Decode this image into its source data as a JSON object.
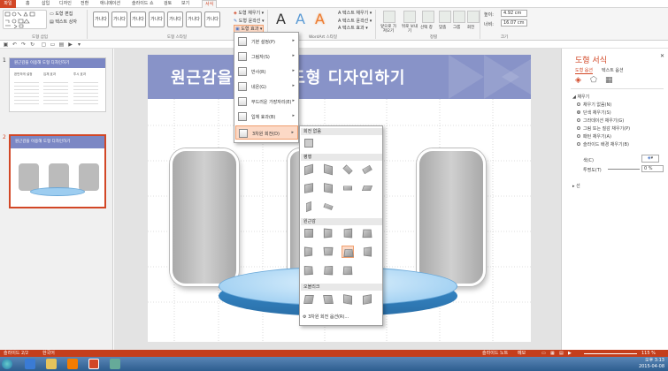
{
  "tabs": [
    "파일",
    "홈",
    "삽입",
    "디자인",
    "전환",
    "애니메이션",
    "슬라이드 쇼",
    "검토",
    "보기",
    "서식"
  ],
  "ribbon": {
    "style_thumb_text": "가나다",
    "shape_styles_label": "도형 스타일",
    "insert_shapes_label": "도형 삽입",
    "edit_shape": "도형 편집",
    "textbox": "텍스트 상자",
    "fill": "도형 채우기",
    "outline": "도형 윤곽선",
    "effects": "도형 효과",
    "wordart_letter": "A",
    "wordart_label": "WordArt 스타일",
    "text_fill": "텍스트 채우기",
    "text_outline": "텍스트 윤곽선",
    "text_effects": "텍스트 효과",
    "arrange_label": "정렬",
    "bring_forward": "앞으로 가져오기",
    "send_backward": "뒤로 보내기",
    "selection_pane": "선택 창",
    "align": "맞춤",
    "group": "그룹",
    "rotate": "회전",
    "size_label": "크기",
    "height_label": "높이:",
    "height_value": "4.92 cm",
    "width_label": "너비:",
    "width_value": "16.07 cm"
  },
  "effects_menu": [
    {
      "label": "기본 설정(P)",
      "arrow": "▸"
    },
    {
      "label": "그림자(S)",
      "arrow": "▸"
    },
    {
      "label": "반사(R)",
      "arrow": "▸"
    },
    {
      "label": "네온(G)",
      "arrow": "▸"
    },
    {
      "label": "부드러운 가장자리(E)",
      "arrow": "▸"
    },
    {
      "label": "입체 효과(B)",
      "arrow": "▸"
    },
    {
      "label": "3차원 회전(D)",
      "arrow": "▸"
    }
  ],
  "gallery": {
    "section_none": "회전 없음",
    "section_parallel": "평행",
    "section_perspective": "원근감",
    "section_oblique": "오블리크",
    "options": "3차원 회전 옵션(R)..."
  },
  "slides": [
    {
      "num": "1",
      "title": "원근감을 이용해 도형 디자인하기"
    },
    {
      "num": "2",
      "title": "원근감을 이용해 도형 디자인하기"
    }
  ],
  "slide1_columns": [
    "완만하게 설정",
    "입체 효과",
    "투시 효과"
  ],
  "slide_title_left": "원근감을",
  "slide_title_right": "도형 디자인하기",
  "format_pane": {
    "title": "도형 서식",
    "tab_shape": "도형 옵션",
    "tab_text": "텍스트 옵션",
    "fill_header": "채우기",
    "fill_options": [
      "채우기 없음(N)",
      "단색 채우기(S)",
      "그라데이션 채우기(G)",
      "그림 또는 질감 채우기(P)",
      "패턴 채우기(A)",
      "슬라이드 배경 채우기(B)"
    ],
    "selected_fill_index": 1,
    "color_label": "색(C)",
    "transparency_label": "투명도(T)",
    "transparency_value": "0 %",
    "line_header": "선"
  },
  "status": {
    "slide": "슬라이드 2/2",
    "language": "한국어",
    "notes": "슬라이드 노트",
    "comments": "메모",
    "zoom": "115 %"
  },
  "clock": {
    "time": "오후 3:13",
    "date": "2015-04-08"
  }
}
